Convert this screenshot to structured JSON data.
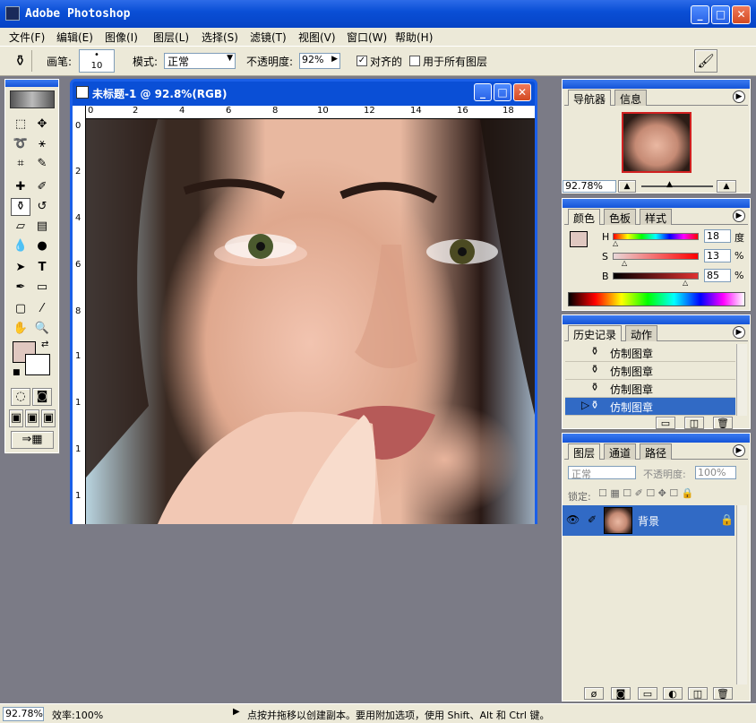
{
  "app": {
    "title": "Adobe Photoshop"
  },
  "menu": [
    "文件(F)",
    "编辑(E)",
    "图像(I)",
    "图层(L)",
    "选择(S)",
    "滤镜(T)",
    "视图(V)",
    "窗口(W)",
    "帮助(H)"
  ],
  "options": {
    "brush_label": "画笔:",
    "brush_size": "10",
    "mode_label": "模式:",
    "mode_value": "正常",
    "opacity_label": "不透明度:",
    "opacity_value": "92%",
    "aligned_label": "对齐的",
    "all_layers_label": "用于所有图层",
    "aligned_checked": true,
    "all_layers_checked": false
  },
  "document": {
    "title": "未标题-1 @ 92.8%(RGB)",
    "ruler_top": [
      "0",
      "2",
      "4",
      "6",
      "8",
      "10",
      "12",
      "14",
      "16",
      "18"
    ],
    "ruler_left": [
      "0",
      "2",
      "4",
      "6",
      "8",
      "1",
      "1",
      "1",
      "1"
    ]
  },
  "navigator": {
    "tabs": [
      "导航器",
      "信息"
    ],
    "zoom": "92.78%"
  },
  "color": {
    "tabs": [
      "颜色",
      "色板",
      "样式"
    ],
    "h_label": "H",
    "h_value": "18",
    "h_unit": "度",
    "s_label": "S",
    "s_value": "13",
    "s_unit": "%",
    "b_label": "B",
    "b_value": "85",
    "b_unit": "%",
    "foreground": "#e0c8c0"
  },
  "history": {
    "tabs": [
      "历史记录",
      "动作"
    ],
    "items": [
      "仿制图章",
      "仿制图章",
      "仿制图章",
      "仿制图章"
    ],
    "selected_index": 3
  },
  "layers": {
    "tabs": [
      "图层",
      "通道",
      "路径"
    ],
    "mode": "正常",
    "opacity_label": "不透明度:",
    "opacity_value": "100%",
    "lock_label": "锁定:",
    "layer_name": "背景"
  },
  "status": {
    "zoom": "92.78%",
    "efficiency": "效率:100%",
    "hint": "点按并拖移以创建副本。要用附加选项，使用 Shift、Alt 和 Ctrl 键。"
  },
  "colors": {
    "xp_blue": "#0a4fd6",
    "panel_bg": "#ece9d8",
    "selection": "#316ac5",
    "workspace": "#7b7b86"
  }
}
